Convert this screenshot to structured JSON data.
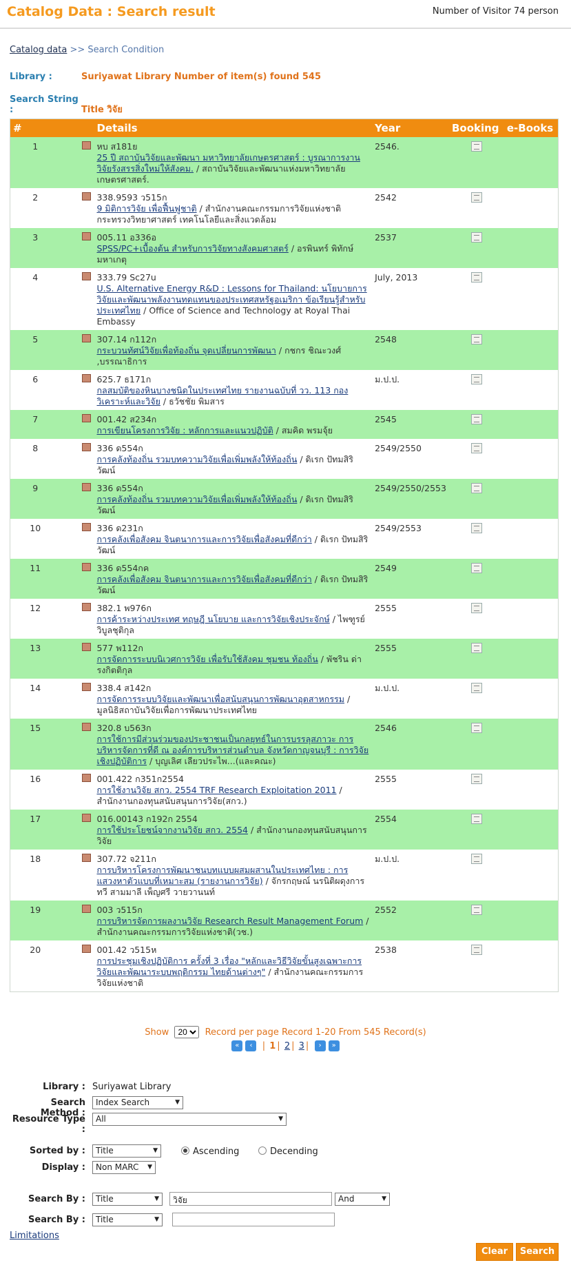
{
  "header": {
    "title": "Catalog Data : Search result",
    "visitor_prefix": "Number of Visitor",
    "visitor_count": "74",
    "visitor_suffix": "person"
  },
  "breadcrumb": {
    "link": "Catalog data",
    "separator": ">>",
    "current": "Search Condition"
  },
  "info": {
    "library_label": "Library :",
    "library_value": "Suriyawat Library Number of item(s) found 545",
    "search_label": "Search String :",
    "search_value": "Title วิจัย"
  },
  "table": {
    "headers": [
      "#",
      "",
      "Details",
      "Year",
      "Booking",
      "e-Books"
    ],
    "rows": [
      {
        "num": "1",
        "call": "หบ ส181ย",
        "title": "25 ปี สถาบันวิจัยและพัฒนา มหาวิทยาลัยเกษตรศาสตร์ : บูรณาการงานวิจัยรังสรรสิ่งใหม่ให้สังคม.",
        "rest": " / สถาบันวิจัยและพัฒนาแห่งมหาวิทยาลัยเกษตรศาสตร์.",
        "year": "2546."
      },
      {
        "num": "2",
        "call": "338.9593 ว515ก",
        "title": "9 มิติการวิจัย เพื่อฟื้นฟูชาติ",
        "rest": " / สำนักงานคณะกรรมการวิจัยแห่งชาติ กระทรวงวิทยาศาสตร์ เทคโนโลยีและสิ่งแวดล้อม",
        "year": "2542"
      },
      {
        "num": "3",
        "call": "005.11 อ336อ",
        "title": "SPSS/PC+เบื้องต้น สำหรับการวิจัยทางสังคมศาสตร์",
        "rest": " / อรพินทร์ พิทักษ์มหาเกตุ",
        "year": "2537"
      },
      {
        "num": "4",
        "call": "333.79 Sc27u",
        "title": "U.S. Alternative Energy R&D : Lessons for Thailand: นโยบายการวิจัยและพัฒนาพลังงานทดแทนของประเทศสหรัฐอเมริกา ข้อเรียนรู้สำหรับประเทศไทย",
        "rest": " / Office of Science and Technology at Royal Thai Embassy",
        "year": "July, 2013"
      },
      {
        "num": "5",
        "call": "307.14 ก112ก",
        "title": "กระบวนทัศน์วิจัยเพื่อท้องถิ่น จุดเปลี่ยนการพัฒนา",
        "rest": " / กชกร ชิณะวงศ์ ,บรรณาธิการ",
        "year": "2548"
      },
      {
        "num": "6",
        "call": "625.7 ธ171ก",
        "title": "กลสมบัติของหินบางชนิดในประเทศไทย รายงานฉบับที่ วว. 113 กองวิเคราะห์และวิจัย",
        "rest": " / ธวัชชัย พิมสาร",
        "year": "ม.ป.ป."
      },
      {
        "num": "7",
        "call": "001.42 ส234ก",
        "title": "การเขียนโครงการวิจัย : หลักการและแนวปฏิบัติ",
        "rest": " / สมคิด พรมจุ้ย",
        "year": "2545"
      },
      {
        "num": "8",
        "call": "336 ด554ก",
        "title": "การคลังท้องถิ่น รวมบทความวิจัยเพื่อเพิ่มพลังให้ท้องถิ่น",
        "rest": " / ดิเรก ปัทมสิริวัฒน์",
        "year": "2549/2550"
      },
      {
        "num": "9",
        "call": "336 ด554ก",
        "title": "การคลังท้องถิ่น รวมบทความวิจัยเพื่อเพิ่มพลังให้ท้องถิ่น",
        "rest": " / ดิเรก ปัทมสิริวัฒน์",
        "year": "2549/2550/2553"
      },
      {
        "num": "10",
        "call": "336 ด231ก",
        "title": "การคลังเพื่อสังคม จินตนาการและการวิจัยเพื่อสังคมที่ดีกว่า",
        "rest": " / ดิเรก ปัทมสิริวัฒน์",
        "year": "2549/2553"
      },
      {
        "num": "11",
        "call": "336 ด554กค",
        "title": "การคลังเพื่อสังคม จินตนาการและการวิจัยเพื่อสังคมที่ดีกว่า",
        "rest": " / ดิเรก ปัทมสิริวัฒน์",
        "year": "2549"
      },
      {
        "num": "12",
        "call": "382.1 พ976ก",
        "title": "การค้าระหว่างประเทศ ทฤษฎี นโยบาย และการวิจัยเชิงประจักษ์",
        "rest": " / ไพฑูรย์ วิบูลชุติกุล",
        "year": "2555"
      },
      {
        "num": "13",
        "call": "577 พ112ก",
        "title": "การจัดการระบบนิเวศการวิจัย เพื่อรับใช้สังคม ชุมชน ท้องถิ่น",
        "rest": " / พัชริน ด่ารงกิตติกุล",
        "year": "2555"
      },
      {
        "num": "14",
        "call": "338.4 ส142ก",
        "title": "การจัดการระบบวิจัยและพัฒนาเพื่อสนับสนุนการพัฒนาอุตสาหกรรม",
        "rest": " / มูลนิธิสถาบันวิจัยเพื่อการพัฒนาประเทศไทย",
        "year": "ม.ป.ป."
      },
      {
        "num": "15",
        "call": "320.8 บ563ก",
        "title": "การใช้การมีส่วนร่วมของประชาชนเป็นกลยุทธ์ในการบรรลุสภาวะ การบริหารจัดการที่ดี ณ องค์การบริหารส่วนตำบล จังหวัดกาญจนบุรี : การวิจัยเชิงปฏิบัติการ",
        "rest": " / บุญเลิศ เลียวประไพ...(และคณะ)",
        "year": "2546"
      },
      {
        "num": "16",
        "call": "001.422 ก351ก2554",
        "title": "การใช้งานวิจัย สกว. 2554 TRF Research Exploitation 2011",
        "rest": " / สำนักงานกองทุนสนับสนุนการวิจัย(สกว.)",
        "year": "2555"
      },
      {
        "num": "17",
        "call": "016.00143 ก192ก 2554",
        "title": "การใช้ประโยชน์จากงานวิจัย สกว. 2554",
        "rest": " / สำนักงานกองทุนสนับสนุนการวิจัย",
        "year": "2554"
      },
      {
        "num": "18",
        "call": "307.72 จ211ก",
        "title": "การบริหารโครงการพัฒนาชนบทแบบผสมผสานในประเทศไทย : การแสวงหาตัวแบบที่เหมาะสม (รายงานการวิจัย)",
        "rest": " / จักรกฤษณ์ นรนิติผดุงการ ทวี สามมาลี เพ็ญศรี วายวานนท์",
        "year": "ม.ป.ป."
      },
      {
        "num": "19",
        "call": "003 ว515ก",
        "title": "การบริหารจัดการผลงานวิจัย Research Result Management Forum",
        "rest": " / สำนักงานคณะกรรมการวิจัยแห่งชาติ(วช.)",
        "year": "2552"
      },
      {
        "num": "20",
        "call": "001.42 ว515ห",
        "title": "การประชุมเชิงปฏิบัติการ ครั้งที่ 3 เรื่อง \"หลักและวิธีวิจัยขั้นสูงเฉพาะการวิจัยและพัฒนาระบบพฤติกรรม ไทยด้านต่างๆ\"",
        "rest": " / สำนักงานคณะกรรมการวิจัยแห่งชาติ",
        "year": "2538"
      }
    ]
  },
  "pager": {
    "show_label": "Show",
    "per_page": "20",
    "summary": "Record per page Record 1-20 From 545 Record(s)",
    "pages": [
      "1",
      "2",
      "3"
    ],
    "current_page": "1",
    "first_icon": "first-page-icon",
    "prev_icon": "prev-page-icon",
    "next_icon": "next-page-icon",
    "last_icon": "last-page-icon"
  },
  "form": {
    "library_label": "Library :",
    "library_value": "Suriyawat Library",
    "method_label": "Search Method :",
    "method_value": "Index Search",
    "resource_label": "Resource Type :",
    "resource_value": "All",
    "sorted_label": "Sorted by :",
    "sorted_value": "Title",
    "asc_label": "Ascending",
    "desc_label": "Decending",
    "display_label": "Display :",
    "display_value": "Non MARC",
    "searchby_label": "Search By :",
    "searchby1_field": "Title",
    "searchby1_text": "วิจัย",
    "searchby1_op": "And",
    "searchby2_field": "Title",
    "searchby2_text": "",
    "limitations": "Limitations",
    "clear": "Clear",
    "search": "Search"
  },
  "colors": {
    "accent": "#f08c10",
    "row_alt": "#a8f0a8",
    "link": "#1a3b7c",
    "label_blue": "#2b7fb0"
  }
}
